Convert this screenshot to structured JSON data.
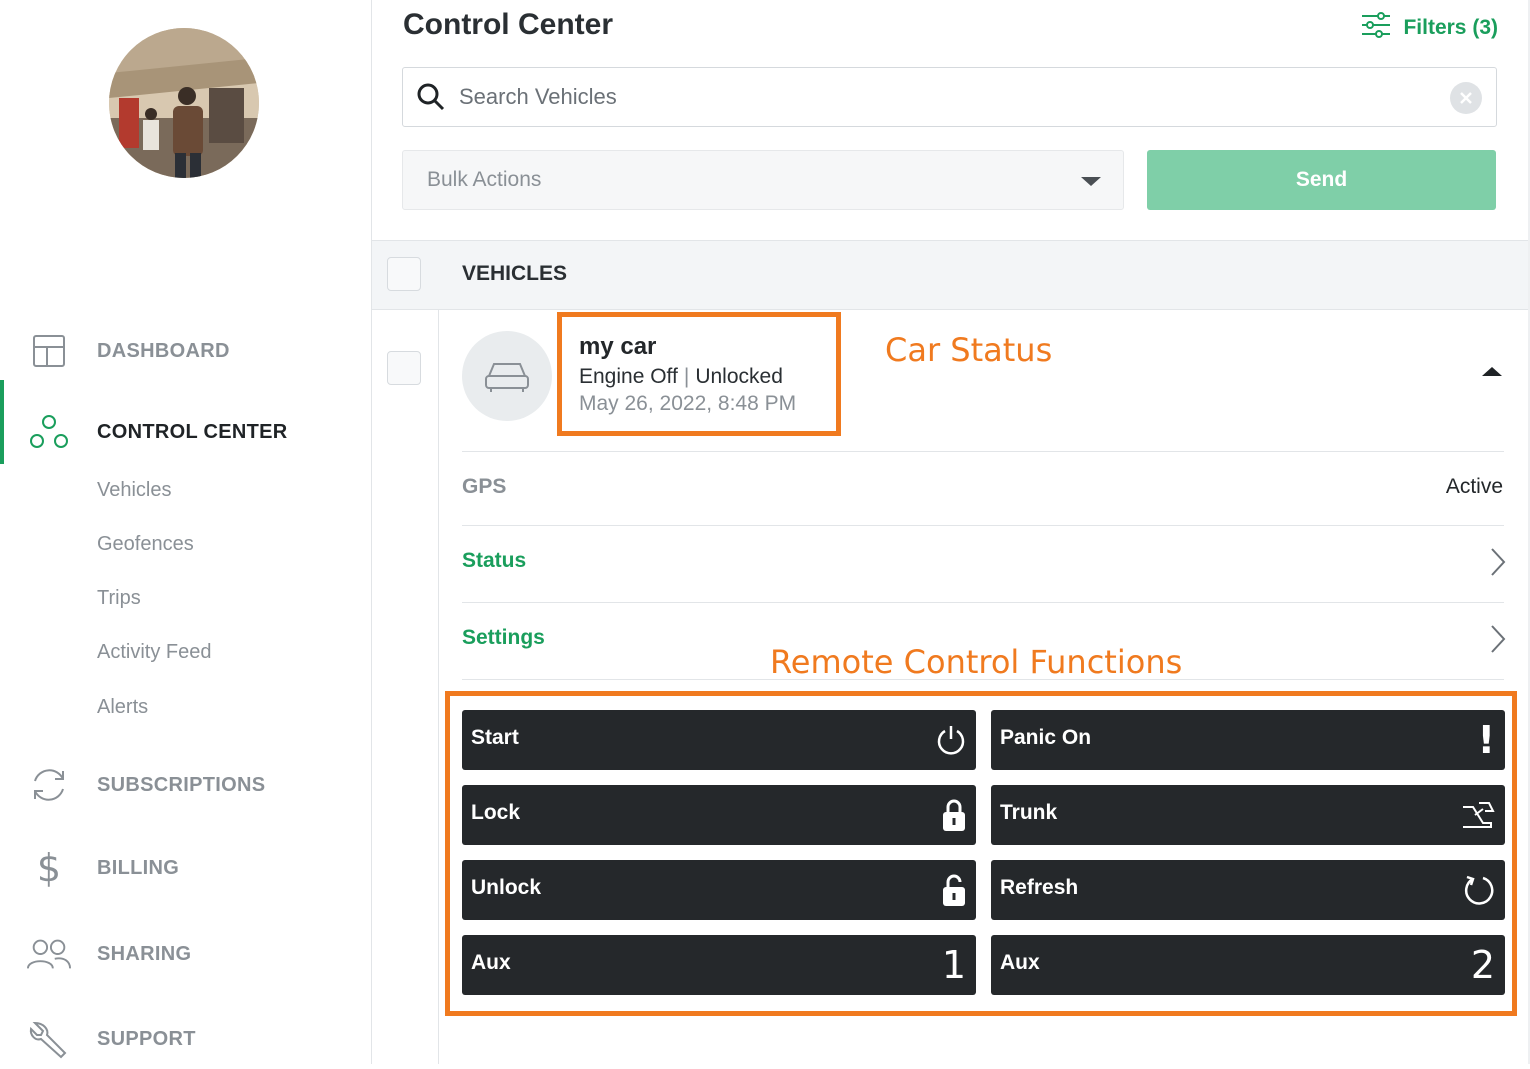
{
  "sidebar": {
    "nav": [
      {
        "label": "DASHBOARD",
        "icon": "dashboard-icon"
      },
      {
        "label": "CONTROL CENTER",
        "icon": "control-center-icon",
        "active": true
      },
      {
        "label": "SUBSCRIPTIONS",
        "icon": "subscriptions-icon"
      },
      {
        "label": "BILLING",
        "icon": "dollar-icon"
      },
      {
        "label": "SHARING",
        "icon": "users-icon"
      },
      {
        "label": "SUPPORT",
        "icon": "wrench-icon"
      }
    ],
    "sub": [
      "Vehicles",
      "Geofences",
      "Trips",
      "Activity Feed",
      "Alerts"
    ]
  },
  "header": {
    "title": "Control Center",
    "filters_label": "Filters (3)"
  },
  "search": {
    "placeholder": "Search Vehicles"
  },
  "bulk": {
    "label": "Bulk Actions",
    "send_label": "Send"
  },
  "table": {
    "header": "VEHICLES"
  },
  "vehicle": {
    "name": "my car",
    "engine": "Engine Off",
    "lock_state": "Unlocked",
    "timestamp": "May 26, 2022, 8:48 PM",
    "gps_label": "GPS",
    "gps_value": "Active",
    "status_label": "Status",
    "settings_label": "Settings"
  },
  "annotations": {
    "car_status": "Car Status",
    "remote_functions": "Remote Control Functions"
  },
  "remote": {
    "start": "Start",
    "panic": "Panic On",
    "lock": "Lock",
    "trunk": "Trunk",
    "unlock": "Unlock",
    "refresh": "Refresh",
    "aux1": "Aux",
    "aux1_num": "1",
    "aux2": "Aux",
    "aux2_num": "2"
  },
  "colors": {
    "accent": "#1a9e5c",
    "annotation": "#f07a1f",
    "button_dark": "#25282b",
    "send_bg": "#7fcfa8"
  }
}
